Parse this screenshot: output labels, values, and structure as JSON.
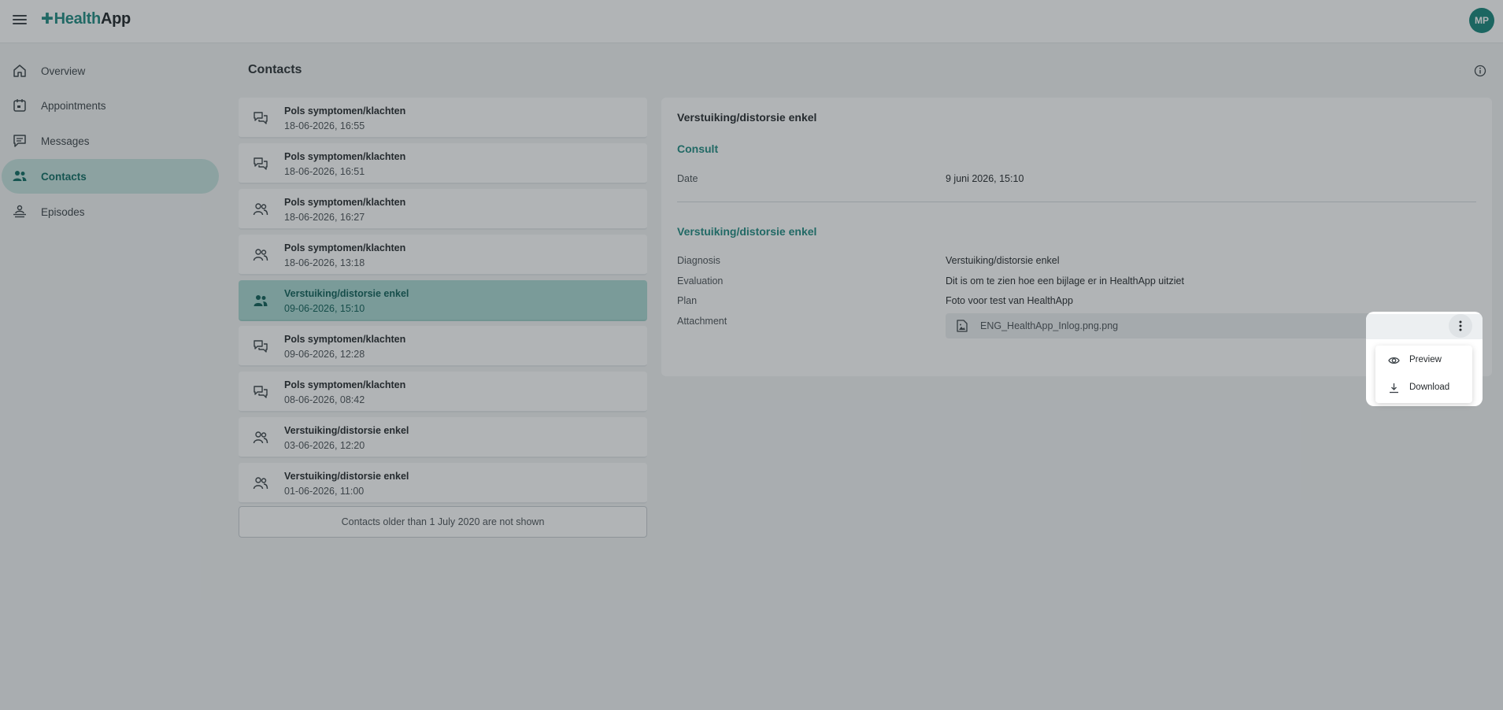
{
  "app": {
    "logo_part1": "Health",
    "logo_part2": "App",
    "user_initials": "MP",
    "accent_color": "#1f8a80"
  },
  "sidebar": {
    "items": [
      {
        "label": "Overview",
        "icon": "home-icon"
      },
      {
        "label": "Appointments",
        "icon": "calendar-icon"
      },
      {
        "label": "Messages",
        "icon": "message-icon"
      },
      {
        "label": "Contacts",
        "icon": "people-icon",
        "active": true
      },
      {
        "label": "Episodes",
        "icon": "person-stack-icon"
      }
    ]
  },
  "main": {
    "title": "Contacts",
    "contacts": [
      {
        "title": "Pols symptomen/klachten",
        "date": "18-06-2026, 16:55",
        "icon": "chat-icon"
      },
      {
        "title": "Pols symptomen/klachten",
        "date": "18-06-2026, 16:51",
        "icon": "chat-icon"
      },
      {
        "title": "Pols symptomen/klachten",
        "date": "18-06-2026, 16:27",
        "icon": "people-icon"
      },
      {
        "title": "Pols symptomen/klachten",
        "date": "18-06-2026, 13:18",
        "icon": "people-icon"
      },
      {
        "title": "Verstuiking/distorsie enkel",
        "date": "09-06-2026, 15:10",
        "icon": "people-icon",
        "selected": true
      },
      {
        "title": "Pols symptomen/klachten",
        "date": "09-06-2026, 12:28",
        "icon": "chat-icon"
      },
      {
        "title": "Pols symptomen/klachten",
        "date": "08-06-2026, 08:42",
        "icon": "chat-icon"
      },
      {
        "title": "Verstuiking/distorsie enkel",
        "date": "03-06-2026, 12:20",
        "icon": "people-icon"
      },
      {
        "title": "Verstuiking/distorsie enkel",
        "date": "01-06-2026, 11:00",
        "icon": "people-icon"
      }
    ],
    "older_note": "Contacts older than 1 July 2020 are not shown"
  },
  "detail": {
    "title": "Verstuiking/distorsie enkel",
    "consult": {
      "heading": "Consult",
      "date_label": "Date",
      "date_value": "9 juni 2026, 15:10"
    },
    "episode": {
      "heading": "Verstuiking/distorsie enkel",
      "diagnosis_label": "Diagnosis",
      "diagnosis_value": "Verstuiking/distorsie enkel",
      "evaluation_label": "Evaluation",
      "evaluation_value": "Dit is om te zien hoe een bijlage er in HealthApp uitziet",
      "plan_label": "Plan",
      "plan_value": "Foto voor test van HealthApp",
      "attachment_label": "Attachment",
      "attachment_file": "ENG_HealthApp_Inlog.png.png"
    }
  },
  "attachment_menu": {
    "preview_label": "Preview",
    "download_label": "Download"
  }
}
